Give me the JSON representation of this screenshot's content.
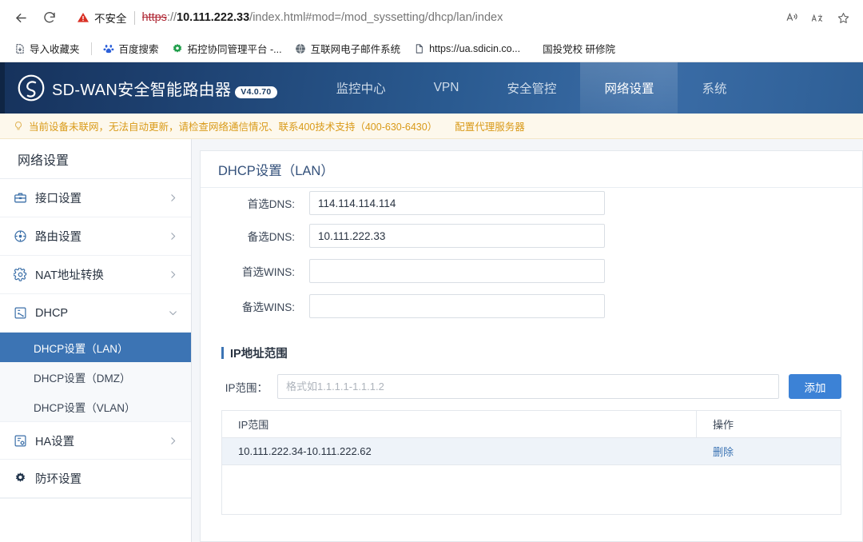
{
  "browser": {
    "back_icon": "back-arrow-icon",
    "reload_icon": "reload-icon",
    "security_label": "不安全",
    "url": {
      "scheme": "https",
      "separator": "://",
      "host": "10.111.222.33",
      "path": "/index.html#mod=/mod_syssetting/dhcp/lan/index"
    },
    "right_icons": [
      {
        "name": "read-aloud-icon",
        "glyph": "A"
      },
      {
        "name": "translate-icon",
        "glyph": "aあ"
      },
      {
        "name": "favorites-icon",
        "glyph": "☆"
      }
    ],
    "bookmarks": [
      {
        "label": "导入收藏夹",
        "icon": "import-bookmarks-icon"
      },
      {
        "label": "百度搜索",
        "icon": "baidu-icon"
      },
      {
        "label": "拓控协同管理平台 -...",
        "icon": "gear-site-icon"
      },
      {
        "label": "互联网电子邮件系统",
        "icon": "globe-icon"
      },
      {
        "label": "https://ua.sdicin.co...",
        "icon": "page-icon"
      },
      {
        "label": "国投党校 研修院",
        "icon": "none"
      }
    ]
  },
  "appbar": {
    "logo_icon": "sdwan-logo-icon",
    "brand": "SD-WAN安全智能路由器",
    "version_badge": "V4.0.70",
    "nav": [
      {
        "label": "监控中心",
        "active": false
      },
      {
        "label": "VPN",
        "active": false
      },
      {
        "label": "安全管控",
        "active": false
      },
      {
        "label": "网络设置",
        "active": true
      },
      {
        "label": "系统",
        "active": false
      }
    ]
  },
  "notice": {
    "icon": "bulb-icon",
    "text": "当前设备未联网，无法自动更新，请检查网络通信情况、联系400技术支持（400-630-6430）",
    "link": "配置代理服务器"
  },
  "sidebar": {
    "title": "网络设置",
    "items": [
      {
        "label": "接口设置",
        "icon": "interface-icon",
        "expandable": true,
        "expanded": false
      },
      {
        "label": "路由设置",
        "icon": "route-icon",
        "expandable": true,
        "expanded": false
      },
      {
        "label": "NAT地址转换",
        "icon": "nat-gear-icon",
        "expandable": true,
        "expanded": false
      },
      {
        "label": "DHCP",
        "icon": "dhcp-icon",
        "expandable": true,
        "expanded": true
      },
      {
        "label": "HA设置",
        "icon": "ha-icon",
        "expandable": true,
        "expanded": false
      },
      {
        "label": "防环设置",
        "icon": "loop-guard-icon",
        "expandable": false,
        "expanded": false
      }
    ],
    "dhcp_children": [
      {
        "label": "DHCP设置（LAN）",
        "active": true
      },
      {
        "label": "DHCP设置（DMZ）",
        "active": false
      },
      {
        "label": "DHCP设置（VLAN）",
        "active": false
      }
    ]
  },
  "page": {
    "title": "DHCP设置（LAN）",
    "fields": [
      {
        "label": "首选DNS:",
        "value": "114.114.114.114",
        "placeholder": ""
      },
      {
        "label": "备选DNS:",
        "value": "10.111.222.33",
        "placeholder": ""
      },
      {
        "label": "首选WINS:",
        "value": "",
        "placeholder": ""
      },
      {
        "label": "备选WINS:",
        "value": "",
        "placeholder": ""
      }
    ],
    "ip_range_section": {
      "title": "IP地址范围",
      "input_label": "IP范围：",
      "input_value": "",
      "input_placeholder": "格式如1.1.1.1-1.1.1.2",
      "add_button": "添加",
      "table": {
        "columns": [
          "IP范围",
          "操作"
        ],
        "rows": [
          {
            "range": "10.111.222.34-10.111.222.62",
            "action": "删除"
          }
        ]
      }
    }
  },
  "colors": {
    "brand_blue": "#2a5a90",
    "accent": "#3c74b4",
    "button_blue": "#3c82d6",
    "notice_amber": "#d99a19",
    "danger_red": "#b02a37"
  }
}
